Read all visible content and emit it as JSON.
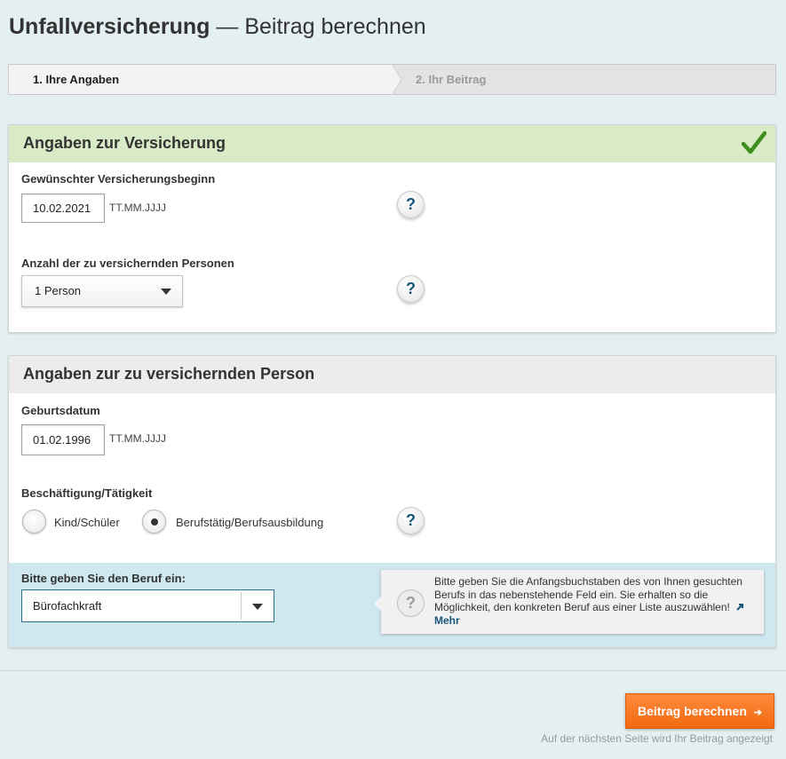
{
  "page": {
    "title_bold": "Unfallversicherung",
    "title_rest": " — Beitrag berechnen"
  },
  "stepper": {
    "step1": "1. Ihre Angaben",
    "step2": "2. Ihr Beitrag",
    "active_step": 1
  },
  "insurance_panel": {
    "heading": "Angaben zur Versicherung",
    "completed_icon": "check-icon",
    "start_label": "Gewünschter Versicherungsbeginn",
    "start_value": "10.02.2021",
    "start_hint": "TT.MM.JJJJ",
    "persons_label": "Anzahl der zu versichernden Personen",
    "persons_value": "1 Person",
    "help_symbol": "?"
  },
  "person_panel": {
    "heading": "Angaben zur zu versichernden Person",
    "birthdate_label": "Geburtsdatum",
    "birthdate_value": "01.02.1996",
    "birthdate_hint": "TT.MM.JJJJ",
    "occupation_label": "Beschäftigung/Tätigkeit",
    "options": [
      {
        "label": "Kind/Schüler",
        "selected": false
      },
      {
        "label": "Berufstätig/Berufsausbildung",
        "selected": true
      }
    ],
    "profession_label": "Bitte geben Sie den Beruf ein:",
    "profession_value": "Bürofachkraft",
    "tip_text": "Bitte geben Sie die Anfangsbuchstaben des von Ihnen gesuchten Berufs in das nebenstehende Feld ein. Sie erhalten so die Möglichkeit, den konkreten Beruf aus einer Liste auszuwählen!",
    "tip_link": "Mehr"
  },
  "footer": {
    "cta_label": "Beitrag berechnen",
    "cta_arrow": "➔",
    "note": "Auf der nächsten Seite wird Ihr Beitrag angezeigt"
  },
  "colors": {
    "accent_orange": "#f06a10",
    "link_blue": "#17567a",
    "success_green": "#3e8e1e",
    "panel_head_green": "#d9eac7"
  }
}
